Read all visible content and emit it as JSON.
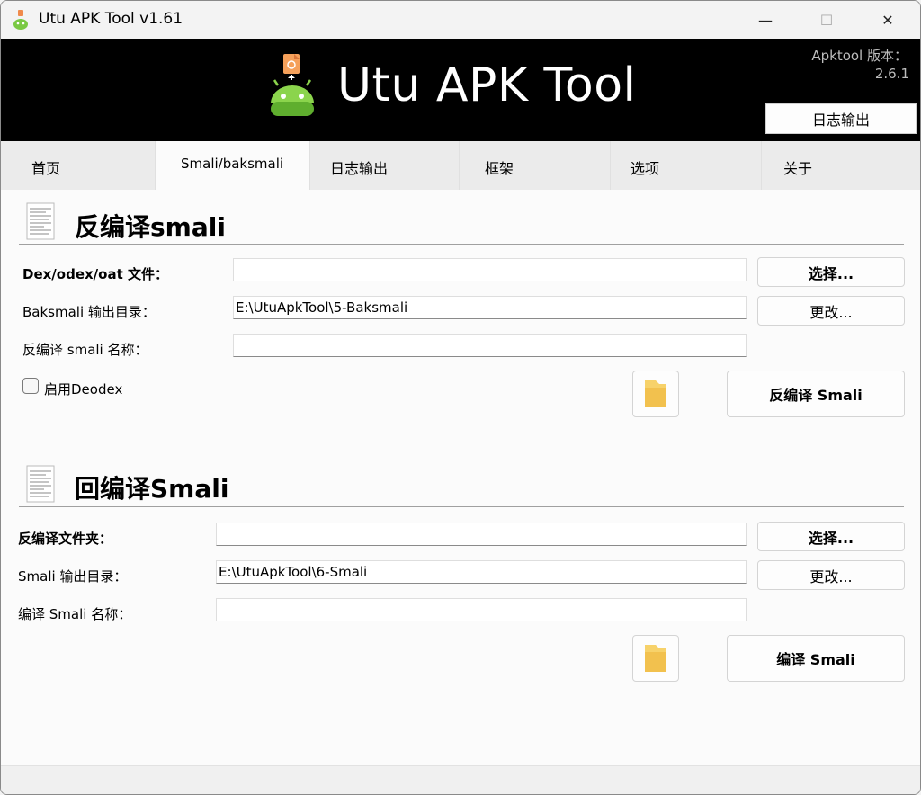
{
  "window": {
    "title": "Utu APK Tool v1.61",
    "controls": {
      "minimize": "—",
      "maximize": "☐",
      "close": "✕"
    }
  },
  "banner": {
    "title": "Utu APK Tool",
    "version_label": "Apktool 版本：",
    "version_value": "2.6.1",
    "log_button": "日志输出"
  },
  "tabs": [
    {
      "label": "首页"
    },
    {
      "label": "Smali/baksmali",
      "active": true
    },
    {
      "label": "日志输出"
    },
    {
      "label": "框架"
    },
    {
      "label": "选项"
    },
    {
      "label": "关于"
    }
  ],
  "baksmali": {
    "title": "反编译smali",
    "dex_label": "Dex/odex/oat 文件：",
    "dex_value": "",
    "select_button": "选择...",
    "output_label": "Baksmali 输出目录：",
    "output_value": "E:\\UtuApkTool\\5-Baksmali",
    "change_button": "更改...",
    "name_label": "反编译 smali 名称：",
    "name_value": "",
    "deodex_label": "启用Deodex",
    "deodex_checked": false,
    "run_button": "反编译 Smali"
  },
  "smali": {
    "title": "回编译Smali",
    "folder_label": "反编译文件夹：",
    "folder_value": "",
    "select_button": "选择...",
    "output_label": "Smali 输出目录：",
    "output_value": "E:\\UtuApkTool\\6-Smali",
    "change_button": "更改...",
    "name_label": "编译 Smali 名称：",
    "name_value": "",
    "run_button": "编译 Smali"
  },
  "colors": {
    "banner_bg": "#000000",
    "folder_yellow": "#f7d26a",
    "android_green": "#7ac943"
  }
}
